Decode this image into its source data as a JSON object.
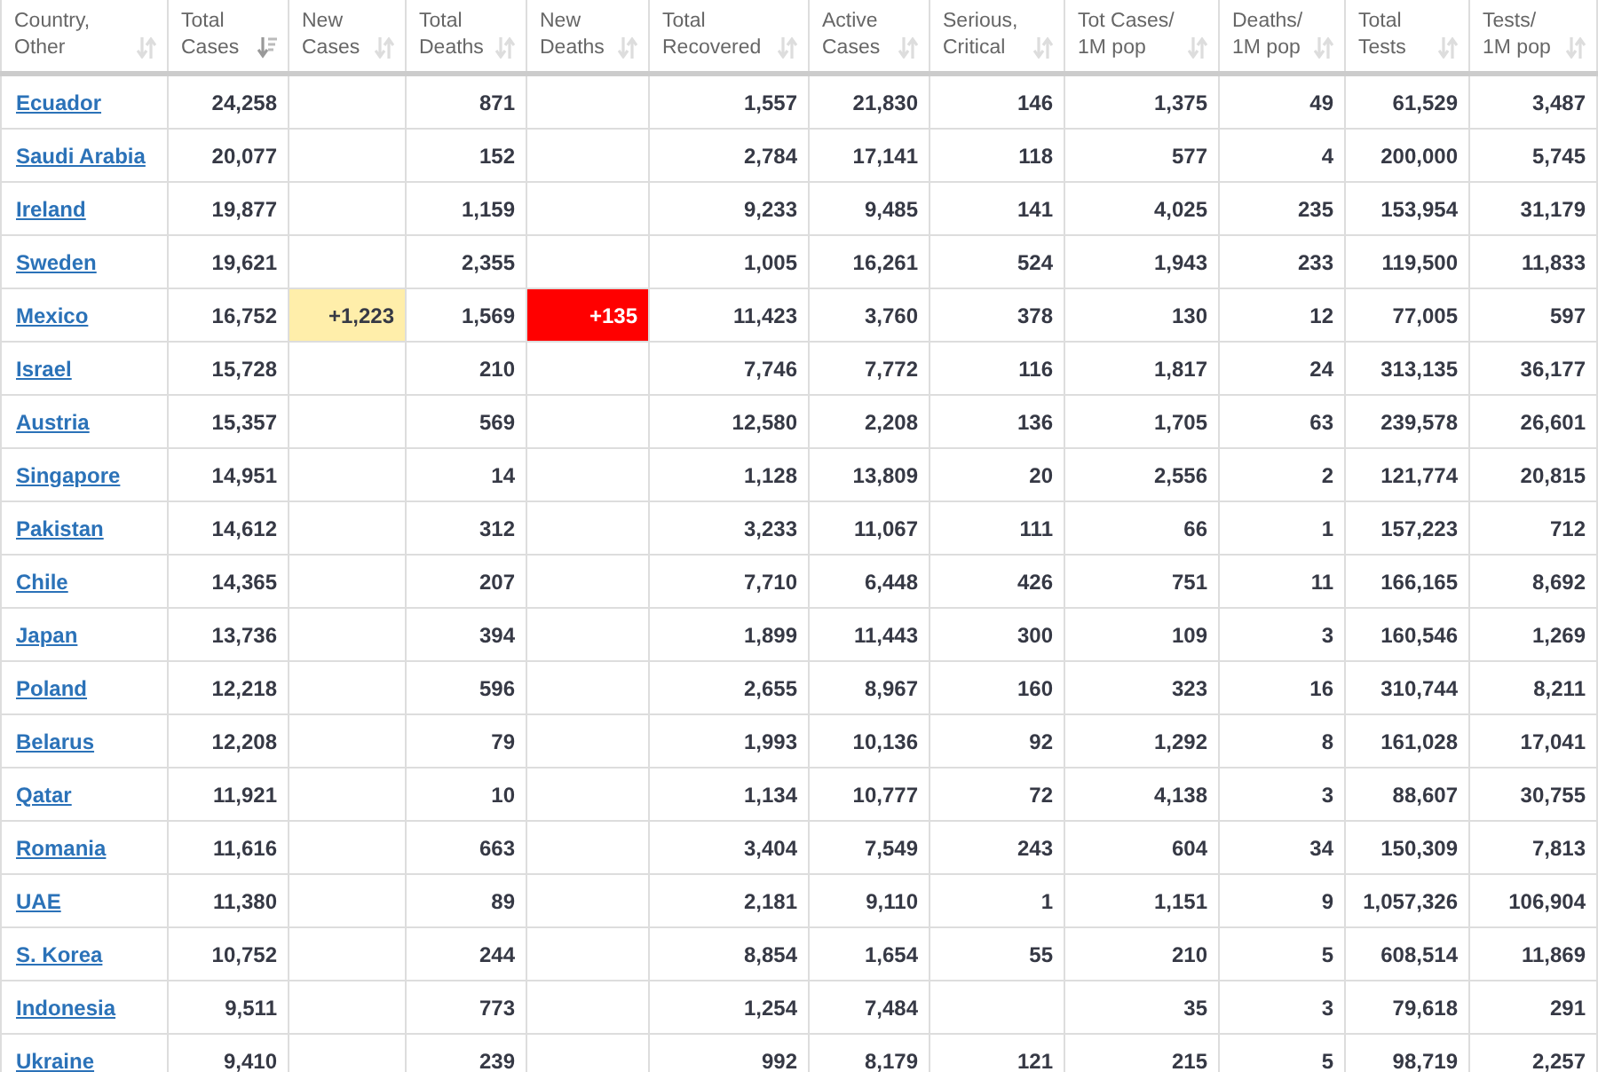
{
  "table": {
    "columns": [
      {
        "label": "Country, Other",
        "kind": "country",
        "sorted": false
      },
      {
        "label": "Total Cases",
        "kind": "plain",
        "sorted": true
      },
      {
        "label": "New Cases",
        "kind": "new-cases",
        "sorted": false
      },
      {
        "label": "Total Deaths",
        "kind": "plain",
        "sorted": false
      },
      {
        "label": "New Deaths",
        "kind": "new-deaths",
        "sorted": false
      },
      {
        "label": "Total Recovered",
        "kind": "plain",
        "sorted": false
      },
      {
        "label": "Active Cases",
        "kind": "plain",
        "sorted": false
      },
      {
        "label": "Serious, Critical",
        "kind": "plain",
        "sorted": false
      },
      {
        "label": "Tot Cases/ 1M pop",
        "kind": "plain",
        "sorted": false
      },
      {
        "label": "Deaths/ 1M pop",
        "kind": "plain",
        "sorted": false
      },
      {
        "label": "Total Tests",
        "kind": "plain",
        "sorted": false
      },
      {
        "label": "Tests/ 1M pop",
        "kind": "plain",
        "sorted": false
      }
    ],
    "rows": [
      {
        "cells": [
          "Ecuador",
          "24,258",
          null,
          "871",
          null,
          "1,557",
          "21,830",
          "146",
          "1,375",
          "49",
          "61,529",
          "3,487"
        ]
      },
      {
        "cells": [
          "Saudi Arabia",
          "20,077",
          null,
          "152",
          null,
          "2,784",
          "17,141",
          "118",
          "577",
          "4",
          "200,000",
          "5,745"
        ]
      },
      {
        "cells": [
          "Ireland",
          "19,877",
          null,
          "1,159",
          null,
          "9,233",
          "9,485",
          "141",
          "4,025",
          "235",
          "153,954",
          "31,179"
        ]
      },
      {
        "cells": [
          "Sweden",
          "19,621",
          null,
          "2,355",
          null,
          "1,005",
          "16,261",
          "524",
          "1,943",
          "233",
          "119,500",
          "11,833"
        ]
      },
      {
        "cells": [
          "Mexico",
          "16,752",
          "+1,223",
          "1,569",
          "+135",
          "11,423",
          "3,760",
          "378",
          "130",
          "12",
          "77,005",
          "597"
        ]
      },
      {
        "cells": [
          "Israel",
          "15,728",
          null,
          "210",
          null,
          "7,746",
          "7,772",
          "116",
          "1,817",
          "24",
          "313,135",
          "36,177"
        ]
      },
      {
        "cells": [
          "Austria",
          "15,357",
          null,
          "569",
          null,
          "12,580",
          "2,208",
          "136",
          "1,705",
          "63",
          "239,578",
          "26,601"
        ]
      },
      {
        "cells": [
          "Singapore",
          "14,951",
          null,
          "14",
          null,
          "1,128",
          "13,809",
          "20",
          "2,556",
          "2",
          "121,774",
          "20,815"
        ]
      },
      {
        "cells": [
          "Pakistan",
          "14,612",
          null,
          "312",
          null,
          "3,233",
          "11,067",
          "111",
          "66",
          "1",
          "157,223",
          "712"
        ]
      },
      {
        "cells": [
          "Chile",
          "14,365",
          null,
          "207",
          null,
          "7,710",
          "6,448",
          "426",
          "751",
          "11",
          "166,165",
          "8,692"
        ]
      },
      {
        "cells": [
          "Japan",
          "13,736",
          null,
          "394",
          null,
          "1,899",
          "11,443",
          "300",
          "109",
          "3",
          "160,546",
          "1,269"
        ]
      },
      {
        "cells": [
          "Poland",
          "12,218",
          null,
          "596",
          null,
          "2,655",
          "8,967",
          "160",
          "323",
          "16",
          "310,744",
          "8,211"
        ]
      },
      {
        "cells": [
          "Belarus",
          "12,208",
          null,
          "79",
          null,
          "1,993",
          "10,136",
          "92",
          "1,292",
          "8",
          "161,028",
          "17,041"
        ]
      },
      {
        "cells": [
          "Qatar",
          "11,921",
          null,
          "10",
          null,
          "1,134",
          "10,777",
          "72",
          "4,138",
          "3",
          "88,607",
          "30,755"
        ]
      },
      {
        "cells": [
          "Romania",
          "11,616",
          null,
          "663",
          null,
          "3,404",
          "7,549",
          "243",
          "604",
          "34",
          "150,309",
          "7,813"
        ]
      },
      {
        "cells": [
          "UAE",
          "11,380",
          null,
          "89",
          null,
          "2,181",
          "9,110",
          "1",
          "1,151",
          "9",
          "1,057,326",
          "106,904"
        ]
      },
      {
        "cells": [
          "S. Korea",
          "10,752",
          null,
          "244",
          null,
          "8,854",
          "1,654",
          "55",
          "210",
          "5",
          "608,514",
          "11,869"
        ]
      },
      {
        "cells": [
          "Indonesia",
          "9,511",
          null,
          "773",
          null,
          "1,254",
          "7,484",
          null,
          "35",
          "3",
          "79,618",
          "291"
        ]
      },
      {
        "cells": [
          "Ukraine",
          "9,410",
          null,
          "239",
          null,
          "992",
          "8,179",
          "121",
          "215",
          "5",
          "98,719",
          "2,257"
        ]
      }
    ]
  }
}
